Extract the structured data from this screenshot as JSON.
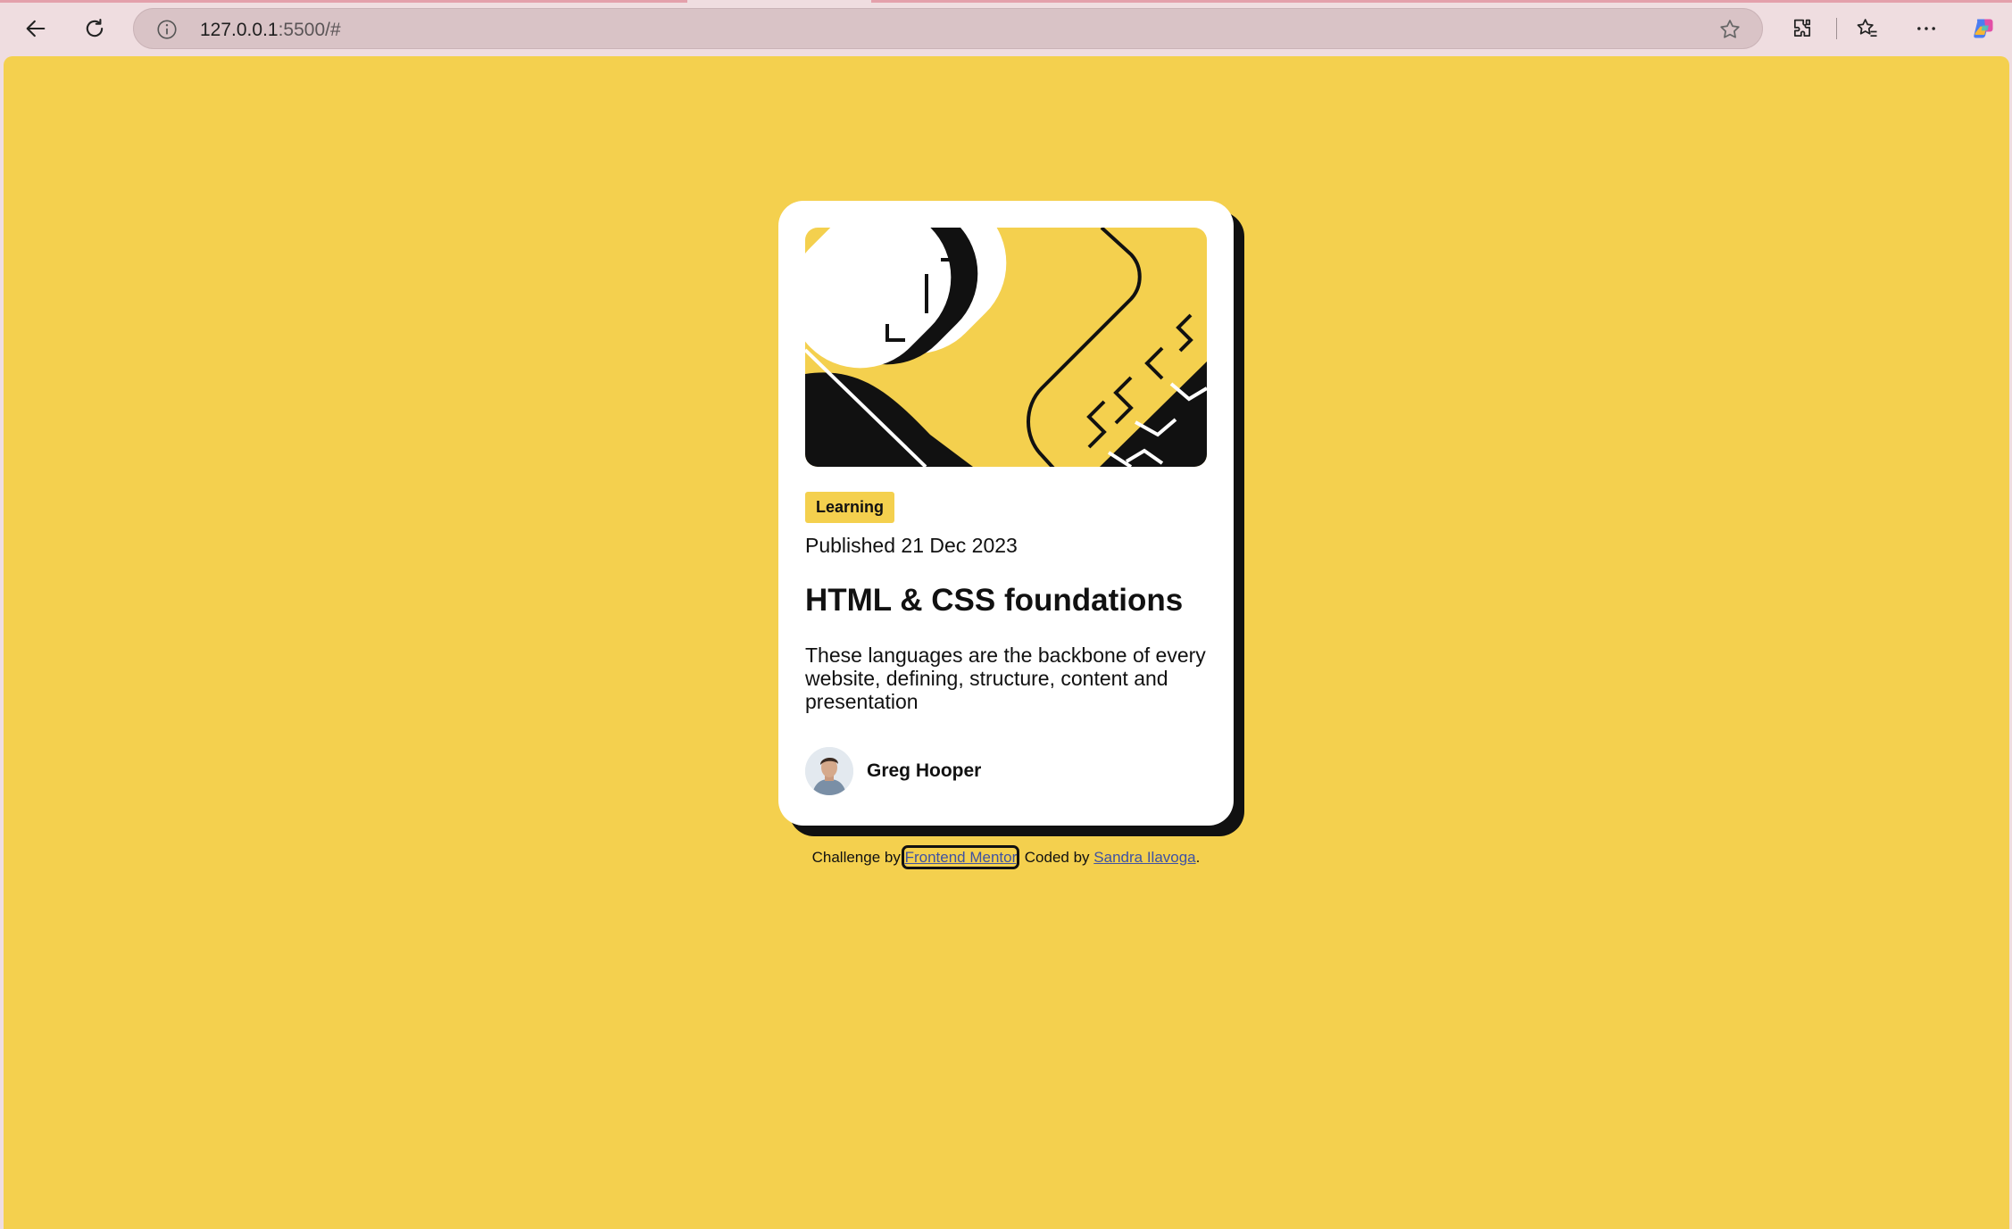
{
  "browser": {
    "url_host": "127.0.0.1",
    "url_rest": ":5500/#",
    "icons": [
      "back-arrow-icon",
      "reload-icon",
      "site-info-icon",
      "favorite-star-icon",
      "extensions-icon",
      "favorites-icon",
      "more-menu-icon",
      "copilot-icon"
    ]
  },
  "card": {
    "tag": "Learning",
    "published": "Published 21 Dec 2023",
    "title": "HTML & CSS foundations",
    "description": "These languages are the backbone of every website, defining, structure, content and presentation",
    "author": "Greg Hooper"
  },
  "attribution": {
    "prefix": "Challenge by ",
    "challenge_link": "Frontend Mentor",
    "middle": ". Coded by ",
    "author_link": "Sandra Ilavoga",
    "suffix": "."
  },
  "colors": {
    "background": "#f4d04e",
    "card": "#ffffff",
    "text": "#111111",
    "accent": "#f4d04e"
  }
}
